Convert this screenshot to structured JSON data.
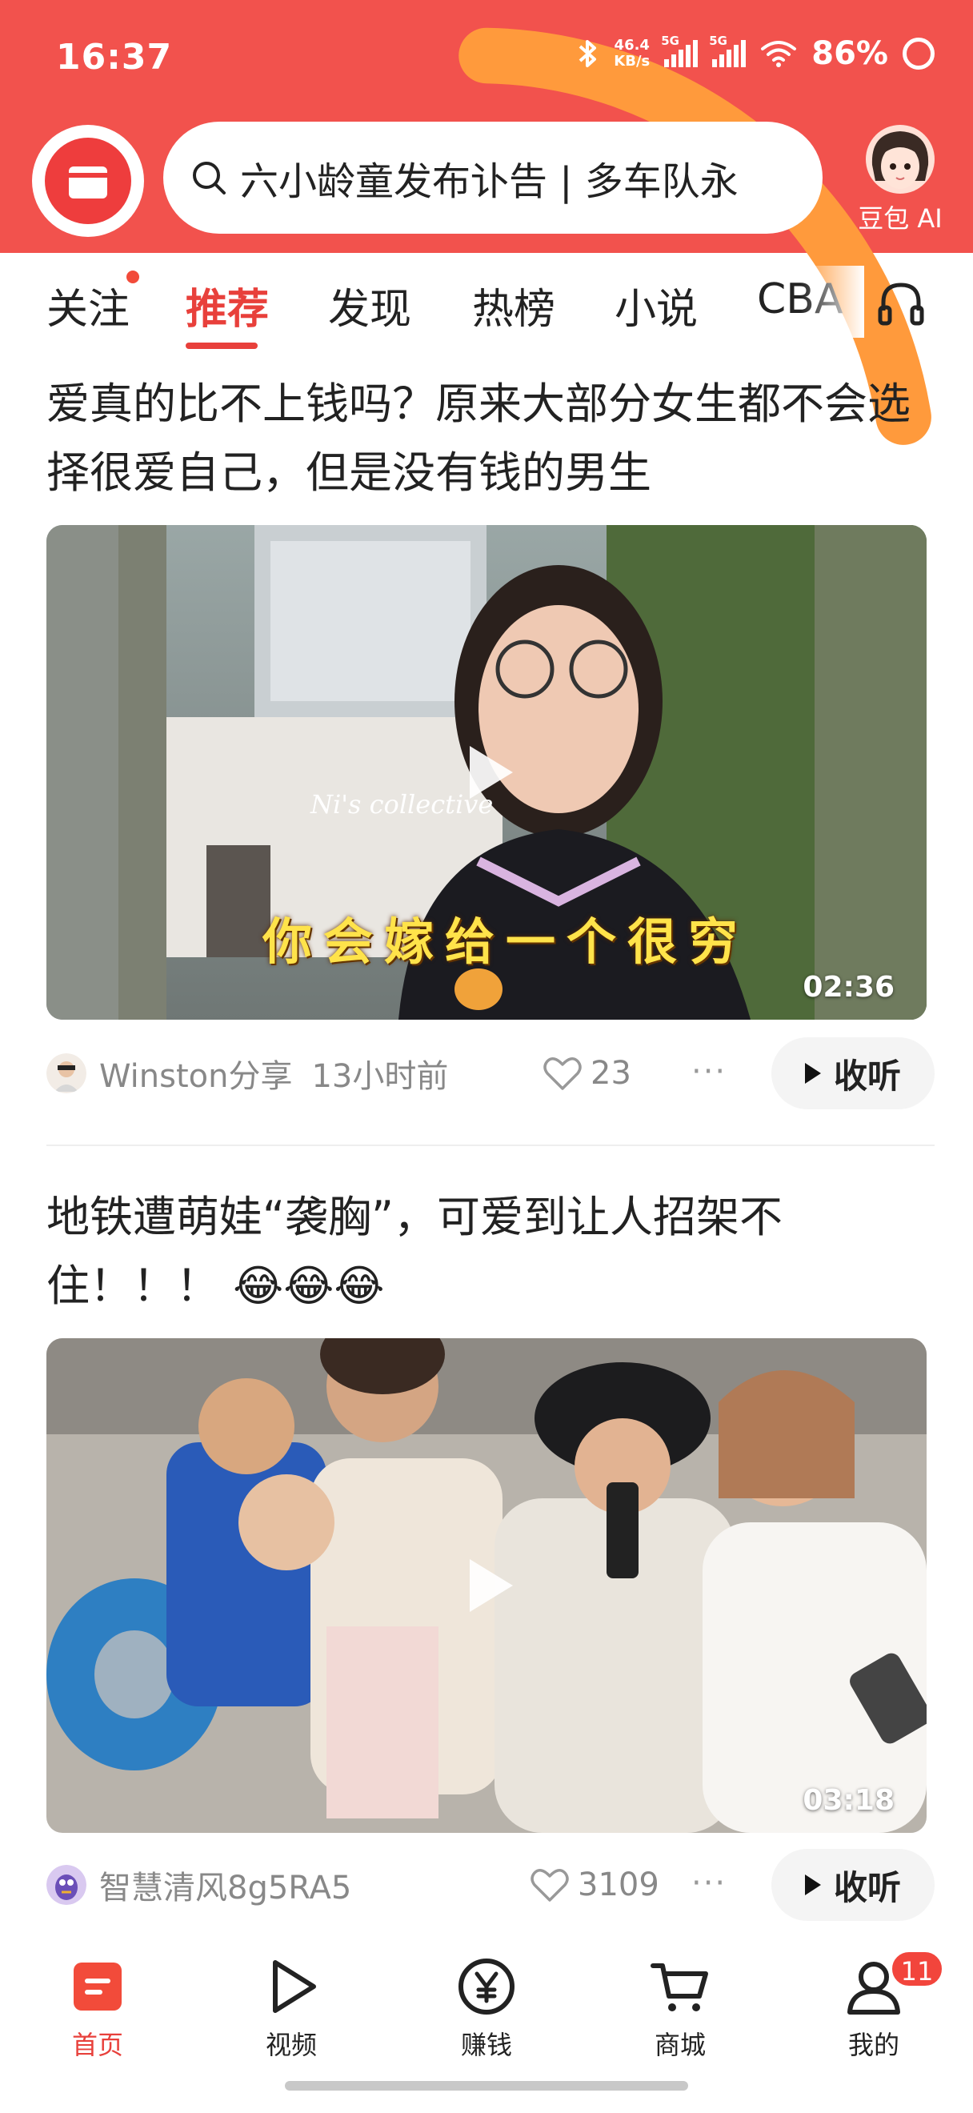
{
  "status_bar": {
    "time": "16:37",
    "net_speed_value": "46.4",
    "net_speed_unit": "KB/s",
    "sim1_label": "5G",
    "sim2_label": "5G",
    "battery": "86%"
  },
  "search": {
    "text": "六小龄童发布讣告 | 多车队永"
  },
  "assistant": {
    "label": "豆包 AI"
  },
  "tabs": [
    {
      "label": "关注",
      "has_dot": true
    },
    {
      "label": "推荐",
      "active": true
    },
    {
      "label": "发现"
    },
    {
      "label": "热榜"
    },
    {
      "label": "小说"
    },
    {
      "label": "CBA"
    }
  ],
  "feed": [
    {
      "title": "爱真的比不上钱吗？原来大部分女生都不会选择很爱自己，但是没有钱的男生",
      "duration": "02:36",
      "caption": "你会嫁给一个很穷",
      "store_sign": "Ni's collective",
      "author": "Winston分享",
      "time_ago": "13小时前",
      "likes": "23",
      "listen_label": "收听"
    },
    {
      "title": "地铁遭萌娃“袭胸”，可爱到让人招架不住！！！ 😂😂😂",
      "duration": "03:18",
      "author": "智慧清风8g5RA5",
      "likes": "3109",
      "listen_label": "收听"
    }
  ],
  "more_glyph": "···",
  "bottom_nav": [
    {
      "label": "首页",
      "icon": "home-icon",
      "active": true
    },
    {
      "label": "视频",
      "icon": "video-play-icon"
    },
    {
      "label": "赚钱",
      "icon": "yuan-coin-icon"
    },
    {
      "label": "商城",
      "icon": "cart-icon"
    },
    {
      "label": "我的",
      "icon": "profile-icon",
      "badge": "11"
    }
  ],
  "colors": {
    "brand_red": "#f2524d",
    "active_red": "#e8403b"
  }
}
